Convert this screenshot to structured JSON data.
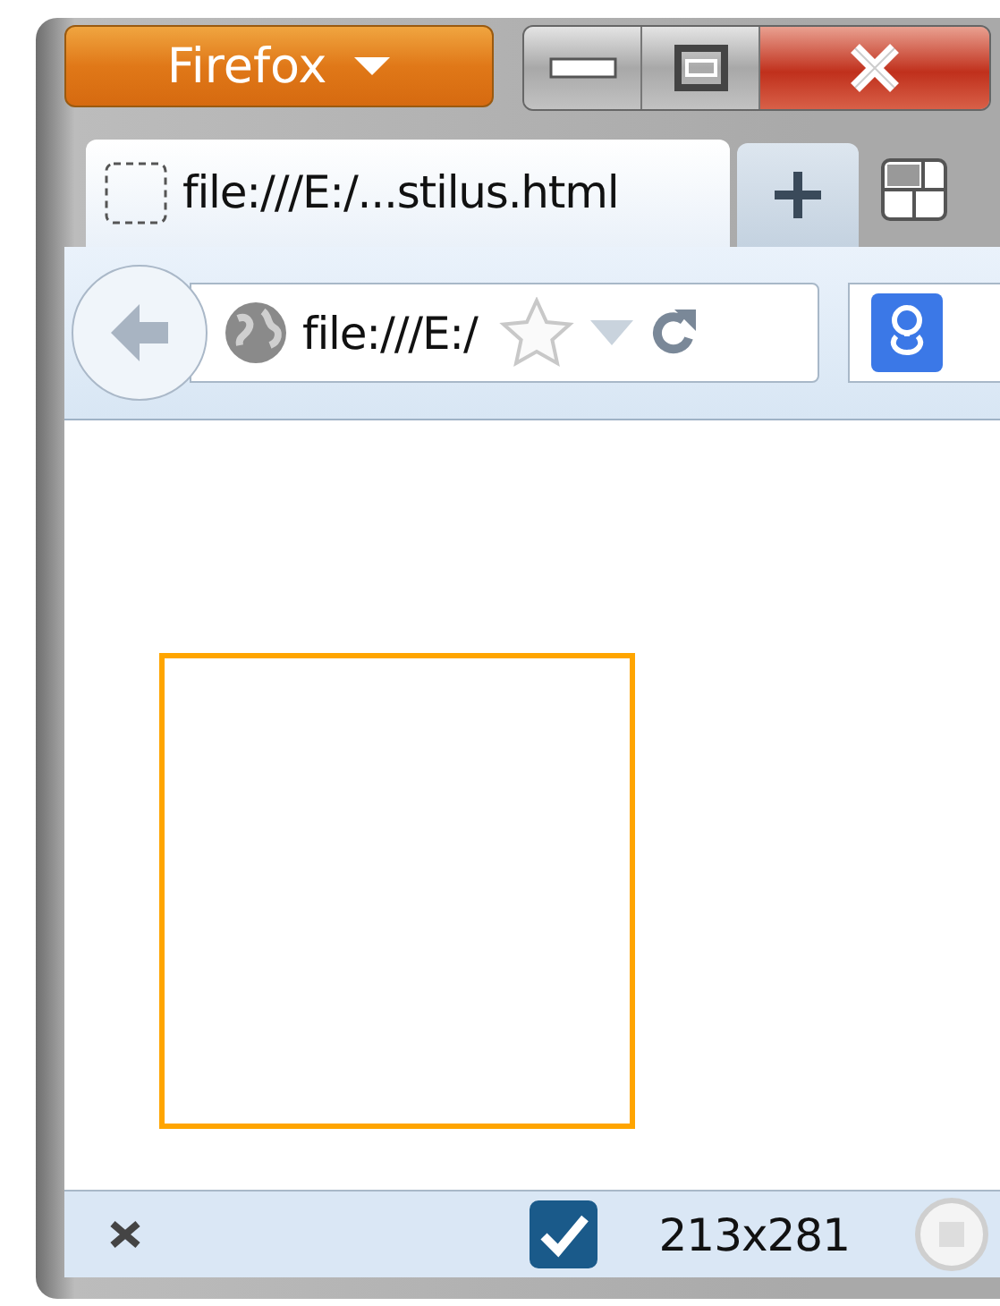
{
  "window": {
    "menu_button": "Firefox"
  },
  "tabs": [
    {
      "title": "file:///E:/...stilus.html",
      "selected": true
    }
  ],
  "nav_bar": {
    "url": "file:///E:/"
  },
  "status_bar": {
    "checked": true,
    "size": "213x281"
  }
}
